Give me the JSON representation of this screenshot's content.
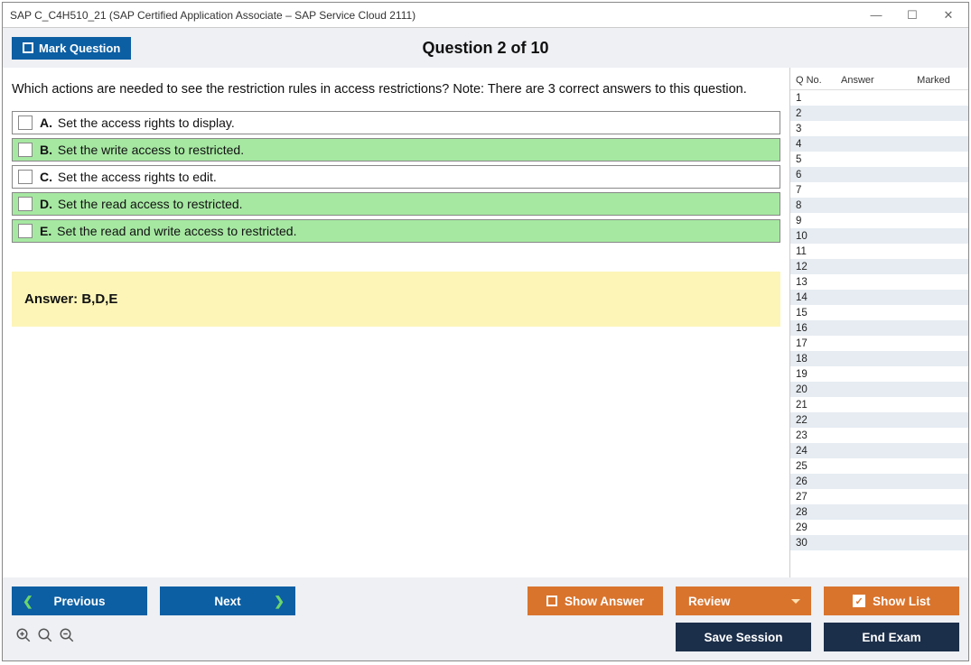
{
  "window": {
    "title": "SAP C_C4H510_21 (SAP Certified Application Associate – SAP Service Cloud 2111)"
  },
  "header": {
    "mark_label": "Mark Question",
    "question_title": "Question 2 of 10"
  },
  "question": {
    "text": "Which actions are needed to see the restriction rules in access restrictions? Note: There are 3 correct answers to this question.",
    "options": [
      {
        "letter": "A.",
        "text": "Set the access rights to display.",
        "correct": false
      },
      {
        "letter": "B.",
        "text": "Set the write access to restricted.",
        "correct": true
      },
      {
        "letter": "C.",
        "text": "Set the access rights to edit.",
        "correct": false
      },
      {
        "letter": "D.",
        "text": "Set the read access to restricted.",
        "correct": true
      },
      {
        "letter": "E.",
        "text": "Set the read and write access to restricted.",
        "correct": true
      }
    ],
    "answer_label": "Answer: B,D,E"
  },
  "sidebar": {
    "head_qno": "Q No.",
    "head_answer": "Answer",
    "head_marked": "Marked",
    "row_count": 30
  },
  "footer": {
    "previous": "Previous",
    "next": "Next",
    "show_answer": "Show Answer",
    "review": "Review",
    "show_list": "Show List",
    "save_session": "Save Session",
    "end_exam": "End Exam"
  }
}
